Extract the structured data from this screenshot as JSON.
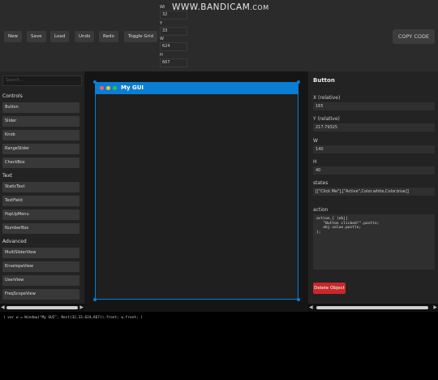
{
  "watermark": {
    "main": "WWW.BANDICAM",
    "suffix": ".COM"
  },
  "toolbar": {
    "buttons": [
      "New",
      "Save",
      "Load",
      "Undo",
      "Redo",
      "Toggle Grid"
    ],
    "copy_code": "COPY CODE"
  },
  "window_fields": {
    "labels": [
      "Wi",
      "Y",
      "W",
      "H"
    ],
    "values": [
      "32",
      "33",
      "624",
      "667"
    ]
  },
  "palette": {
    "search_placeholder": "Search...",
    "sections": [
      {
        "title": "Controls",
        "items": [
          "Button",
          "Slider",
          "Knob",
          "RangeSlider",
          "CheckBox"
        ]
      },
      {
        "title": "Text",
        "items": [
          "StaticText",
          "TextField",
          "PopUpMenu",
          "NumberBox"
        ]
      },
      {
        "title": "Advanced",
        "items": [
          "MultiSliderView",
          "EnvelopeView",
          "UserView",
          "FreqScopeView"
        ]
      }
    ]
  },
  "gui_window": {
    "title": "My GUI",
    "dot_colors": [
      "#ff5f57",
      "#febc2e",
      "#28c840"
    ]
  },
  "inspector": {
    "heading": "Button",
    "x_label": "X (relative)",
    "x_value": "165",
    "y_label": "Y (relative)",
    "y_value": "217.79325",
    "w_label": "W",
    "w_value": "140",
    "h_label": "H",
    "h_value": "40",
    "states_label": "states",
    "states_value": "[[\"Click Me\"],[\"Active\",Color.white,Color.blue]]",
    "action_label": "action",
    "action_code": "action_{ |obj|\n   \"Button clicked!\".postln;\n   obj.value.postln;\n};",
    "delete_label": "Delete Object"
  },
  "console": {
    "output": "( var w = Window(\"My GUI\", Rect(32,33,624,667)).front; w.front; )"
  },
  "colors": {
    "accent": "#0b7dd3",
    "danger": "#c8282a"
  }
}
